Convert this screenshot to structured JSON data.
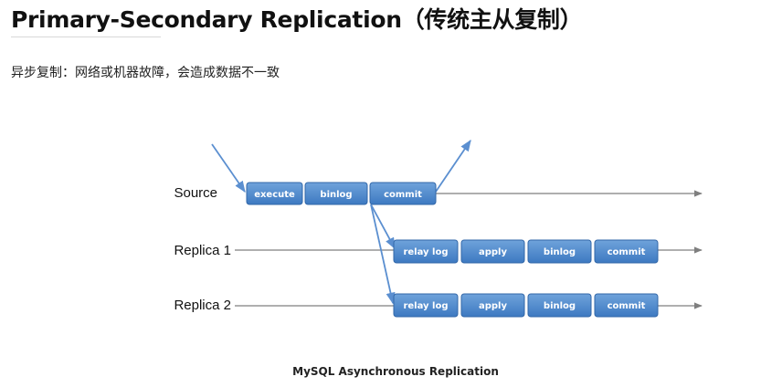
{
  "page": {
    "title": "Primary-Secondary Replication（传统主从复制）",
    "subtitle": "异步复制：网络或机器故障，会造成数据不一致"
  },
  "diagram": {
    "rows": [
      {
        "label": "Source",
        "steps": [
          "execute",
          "binlog",
          "commit"
        ]
      },
      {
        "label": "Replica 1",
        "steps": [
          "relay log",
          "apply",
          "binlog",
          "commit"
        ]
      },
      {
        "label": "Replica 2",
        "steps": [
          "relay log",
          "apply",
          "binlog",
          "commit"
        ]
      }
    ],
    "caption": "MySQL Asynchronous Replication",
    "colors": {
      "box_top": "#6fa3db",
      "box_bottom": "#3d79c1",
      "box_border": "#3267a8",
      "box_text": "#ffffff",
      "arrow_blue": "#5b8fd0",
      "line_gray": "#7f7f7f"
    }
  }
}
